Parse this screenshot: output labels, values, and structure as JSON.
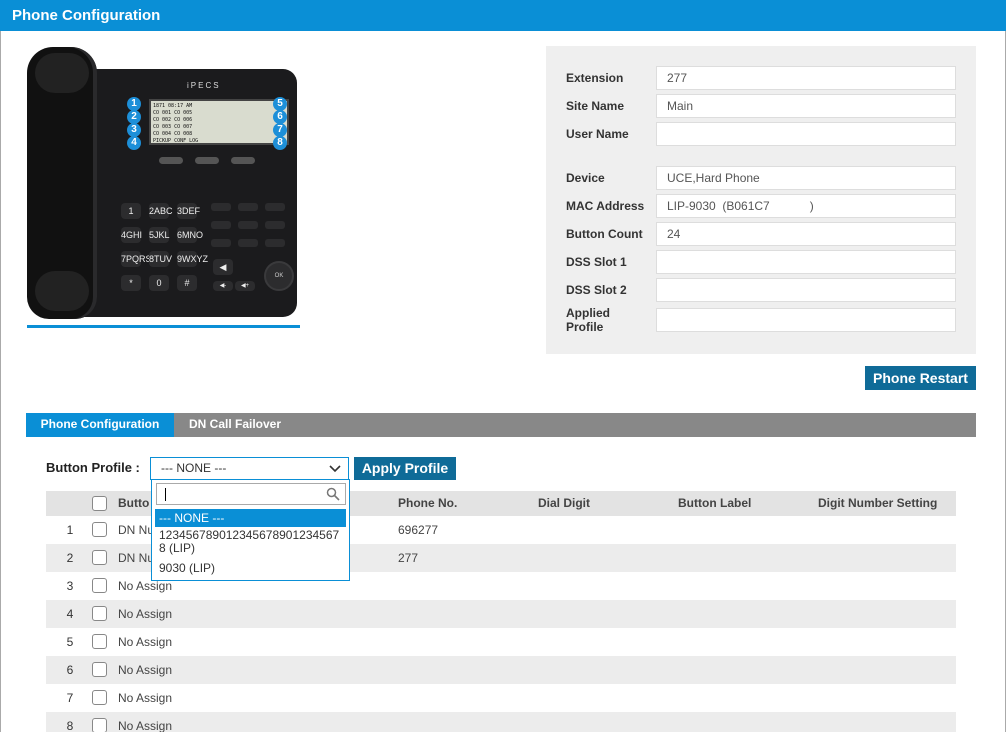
{
  "window": {
    "title": "Phone Configuration"
  },
  "phone_image": {
    "brand": "iPECS",
    "lcd_lines": [
      "1871        08:17 AM",
      "CO 001          CO 005",
      "CO 002          CO 006",
      "CO 003          CO 007",
      "CO 004          CO 008",
      "PICKUP    CONF    LOG"
    ],
    "line_numbers": [
      "1",
      "2",
      "3",
      "4",
      "5",
      "6",
      "7",
      "8"
    ],
    "dial_keys": [
      "1",
      "2ABC",
      "3DEF",
      "4GHI",
      "5JKL",
      "6MNO",
      "7PQRS",
      "8TUV",
      "9WXYZ",
      "*",
      "0",
      "#"
    ],
    "nav_center": "OK"
  },
  "info": {
    "fields": [
      {
        "label": "Extension",
        "value": "277"
      },
      {
        "label": "Site Name",
        "value": "Main"
      },
      {
        "label": "User Name",
        "value": ""
      },
      {
        "label": "Device",
        "value": "UCE,Hard Phone"
      },
      {
        "label": "MAC Address",
        "value": "LIP-9030  (B061C7            )"
      },
      {
        "label": "Button Count",
        "value": "24"
      },
      {
        "label": "DSS Slot 1",
        "value": ""
      },
      {
        "label": "DSS Slot 2",
        "value": ""
      },
      {
        "label": "Applied Profile",
        "value": ""
      }
    ]
  },
  "buttons": {
    "restart": "Phone Restart",
    "apply_profile": "Apply Profile"
  },
  "tabs": [
    {
      "label": "Phone Configuration",
      "active": true
    },
    {
      "label": "DN Call Failover",
      "active": false
    }
  ],
  "button_profile": {
    "label": "Button Profile :",
    "selected": "--- NONE ---",
    "search_value": "",
    "options": [
      "--- NONE ---",
      "123456789012345678901234567 8 (LIP)",
      "9030 (LIP)"
    ]
  },
  "table": {
    "headers": [
      "Butto",
      "Phone No.",
      "Dial Digit",
      "Button Label",
      "Digit Number Setting"
    ],
    "rows": [
      {
        "no": "1",
        "assign": "DN Nu",
        "phone": "696277"
      },
      {
        "no": "2",
        "assign": "DN Nu",
        "phone": "277"
      },
      {
        "no": "3",
        "assign": "No Assign",
        "phone": ""
      },
      {
        "no": "4",
        "assign": "No Assign",
        "phone": ""
      },
      {
        "no": "5",
        "assign": "No Assign",
        "phone": ""
      },
      {
        "no": "6",
        "assign": "No Assign",
        "phone": ""
      },
      {
        "no": "7",
        "assign": "No Assign",
        "phone": ""
      },
      {
        "no": "8",
        "assign": "No Assign",
        "phone": ""
      }
    ]
  },
  "colors": {
    "accent": "#0a8fd6",
    "button": "#0f6b98",
    "tab_bar": "#888888"
  }
}
